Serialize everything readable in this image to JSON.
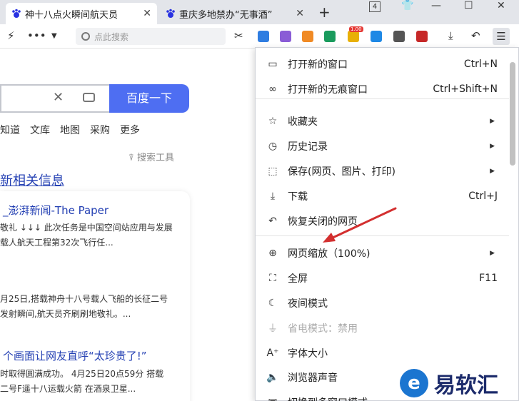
{
  "tabs": [
    {
      "title": "神十八点火瞬间航天员",
      "active": true
    },
    {
      "title": "重庆多地禁办“无事酒”",
      "active": false
    }
  ],
  "tab_count": "4",
  "search_placeholder": "点此搜索",
  "extension_badge": "1.00",
  "ext_colors": [
    "#2f7de1",
    "#8a5cd6",
    "#f08a24",
    "#1a9b5d",
    "#e8b007",
    "#1e88e5",
    "#555555",
    "#c62828",
    "#333333"
  ],
  "page": {
    "search_button": "百度一下",
    "nav": [
      "知道",
      "文库",
      "地图",
      "采购",
      "更多"
    ],
    "search_tools": "搜索工具",
    "news_heading": "新相关信息",
    "news": [
      {
        "title": "_澎湃新闻-The Paper",
        "lines": [
          "敬礼 ↓↓↓ 此次任务是中国空间站应用与发展",
          "载人航天工程第32次飞行任..."
        ]
      },
      {
        "title": "",
        "lines": [
          "月25日,搭载神舟十八号载人飞船的长征二号",
          "发射瞬间,航天员齐刷刷地敬礼。..."
        ]
      },
      {
        "title": "个画面让网友直呼“太珍贵了!”",
        "lines": [
          "时取得圆满成功。 4月25日20点59分 搭载",
          "二号F遥十八运载火箭 在酒泉卫星..."
        ]
      }
    ]
  },
  "menu": {
    "items": [
      {
        "icon": "window-icon",
        "glyph": "▭",
        "label": "打开新的窗口",
        "shortcut": "Ctrl+N",
        "submenu": false,
        "disabled": false
      },
      {
        "icon": "incognito-icon",
        "glyph": "∞",
        "label": "打开新的无痕窗口",
        "shortcut": "Ctrl+Shift+N",
        "submenu": false,
        "disabled": false
      },
      {
        "icon": "star-icon",
        "glyph": "☆",
        "label": "收藏夹",
        "shortcut": "",
        "submenu": true,
        "disabled": false
      },
      {
        "icon": "clock-icon",
        "glyph": "◷",
        "label": "历史记录",
        "shortcut": "",
        "submenu": true,
        "disabled": false
      },
      {
        "icon": "save-icon",
        "glyph": "⬚",
        "label": "保存(网页、图片、打印)",
        "shortcut": "",
        "submenu": true,
        "disabled": false
      },
      {
        "icon": "download-icon",
        "glyph": "⤓",
        "label": "下载",
        "shortcut": "Ctrl+J",
        "submenu": false,
        "disabled": false
      },
      {
        "icon": "undo-icon",
        "glyph": "↶",
        "label": "恢复关闭的网页",
        "shortcut": "",
        "submenu": false,
        "disabled": false
      },
      {
        "icon": "zoom-icon",
        "glyph": "⊕",
        "label": "网页缩放（100%)",
        "shortcut": "",
        "submenu": true,
        "disabled": false
      },
      {
        "icon": "fullscreen-icon",
        "glyph": "⛶",
        "label": "全屏",
        "shortcut": "F11",
        "submenu": false,
        "disabled": false
      },
      {
        "icon": "moon-icon",
        "glyph": "☾",
        "label": "夜间模式",
        "shortcut": "",
        "submenu": false,
        "disabled": false
      },
      {
        "icon": "plug-icon",
        "glyph": "⏚",
        "label": "省电模式：禁用",
        "shortcut": "",
        "submenu": false,
        "disabled": true
      },
      {
        "icon": "font-size-icon",
        "glyph": "A⁺",
        "label": "字体大小",
        "shortcut": "",
        "submenu": false,
        "disabled": false
      },
      {
        "icon": "speaker-icon",
        "glyph": "🔈",
        "label": "浏览器声音",
        "shortcut": "",
        "submenu": false,
        "disabled": false
      },
      {
        "icon": "switch-icon",
        "glyph": "▣",
        "label": "切换到多窗口模式",
        "shortcut": "",
        "submenu": false,
        "disabled": false
      }
    ]
  },
  "watermark": {
    "badge": "e",
    "text": "易软汇"
  }
}
